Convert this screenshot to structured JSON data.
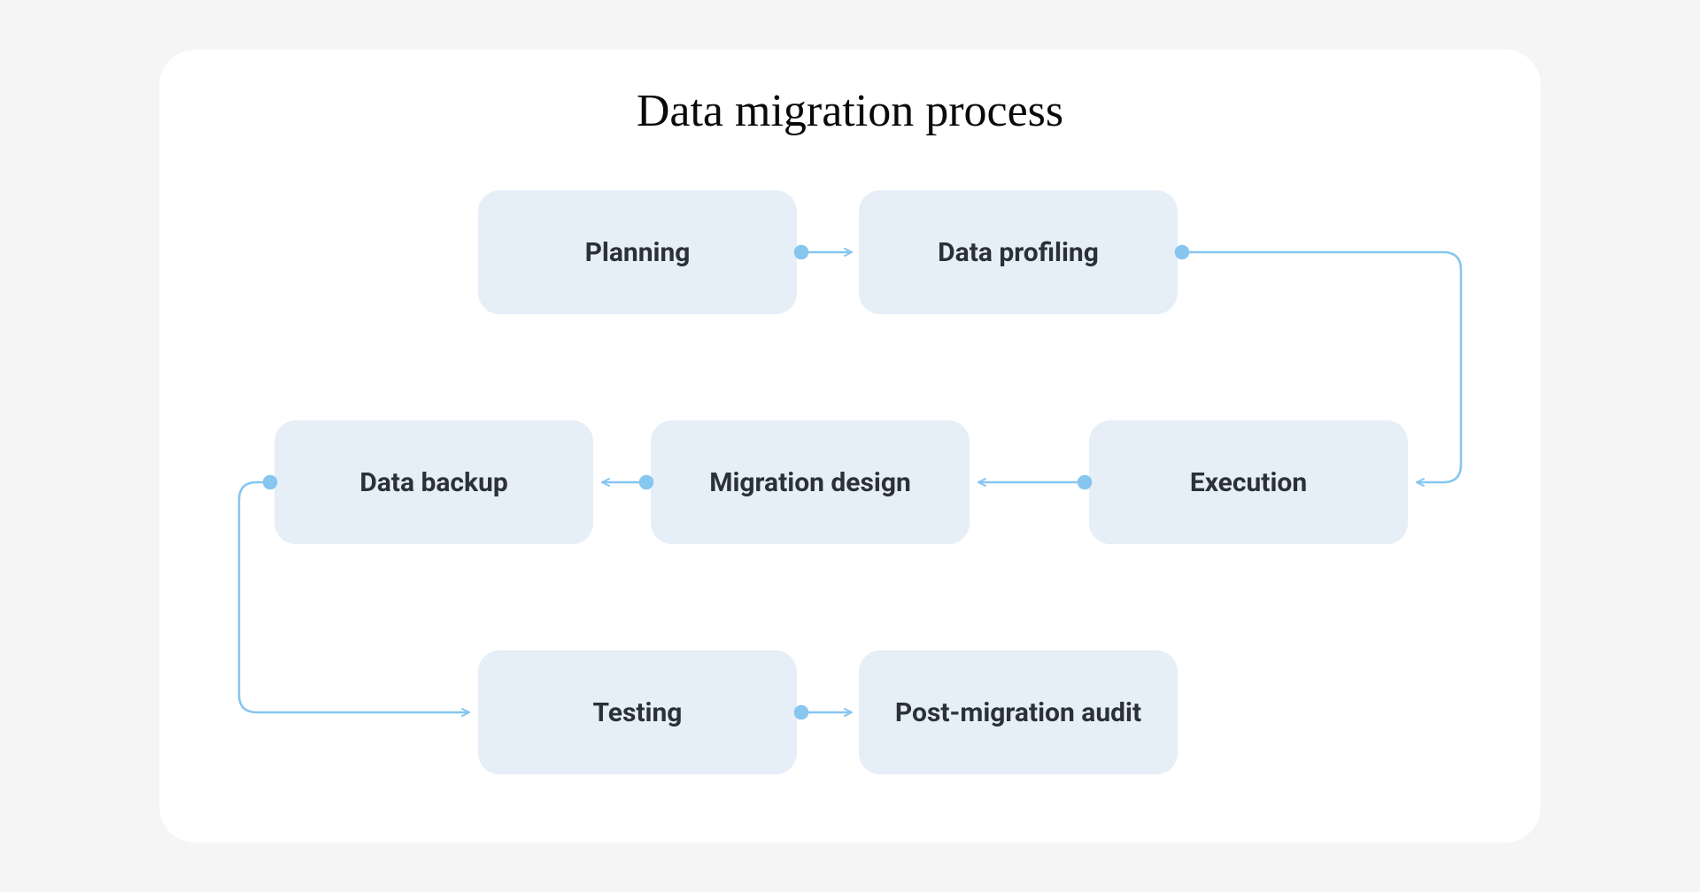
{
  "title": "Data migration process",
  "nodes": {
    "planning": "Planning",
    "profiling": "Data profiling",
    "execution": "Execution",
    "design": "Migration design",
    "backup": "Data backup",
    "testing": "Testing",
    "audit": "Post-migration audit"
  },
  "flow_order": [
    "planning",
    "profiling",
    "execution",
    "design",
    "backup",
    "testing",
    "audit"
  ],
  "colors": {
    "node_bg": "#e6eef7",
    "text": "#2b313b",
    "connector": "#86c6ef",
    "card_bg": "#ffffff"
  }
}
